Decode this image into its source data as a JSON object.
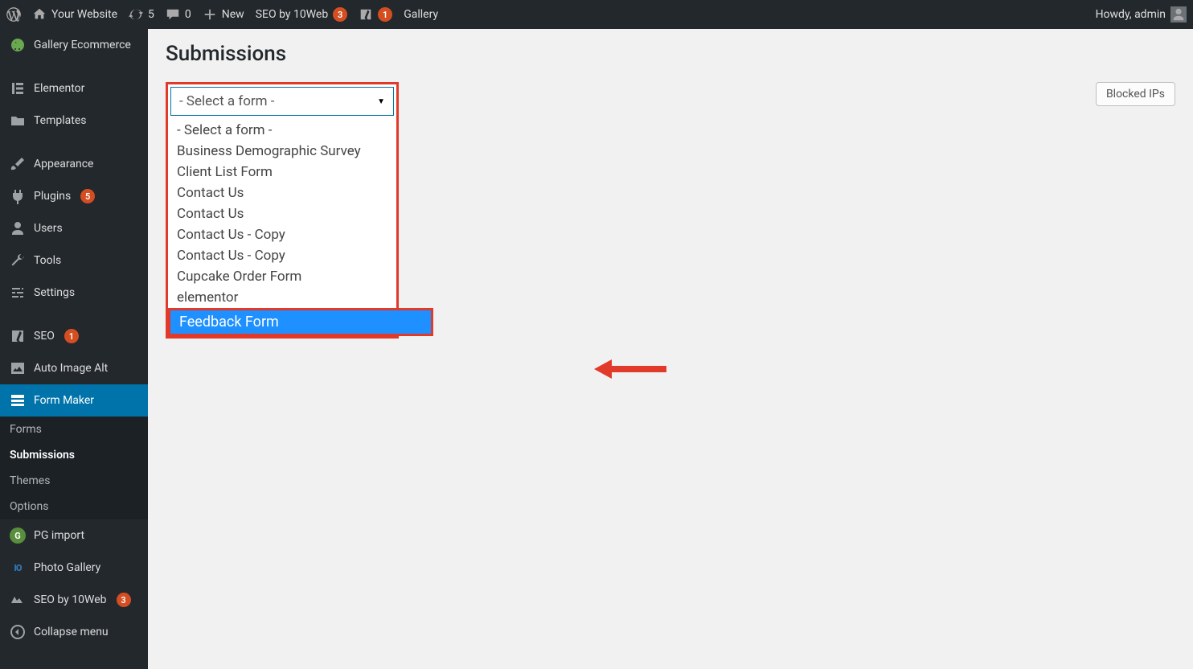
{
  "adminbar": {
    "site_name": "Your Website",
    "refresh_count": "5",
    "comment_count": "0",
    "new_label": "New",
    "seo_label": "SEO by 10Web",
    "seo_badge": "3",
    "yoast_badge": "1",
    "gallery_label": "Gallery",
    "greeting": "Howdy, admin"
  },
  "sidebar": {
    "gallery_ecommerce": "Gallery Ecommerce",
    "elementor": "Elementor",
    "templates": "Templates",
    "appearance": "Appearance",
    "plugins": "Plugins",
    "plugins_badge": "5",
    "users": "Users",
    "tools": "Tools",
    "settings": "Settings",
    "seo": "SEO",
    "seo_badge": "1",
    "auto_image_alt": "Auto Image Alt",
    "form_maker": "Form Maker",
    "sub": {
      "forms": "Forms",
      "submissions": "Submissions",
      "themes": "Themes",
      "options": "Options"
    },
    "pg_import": "PG import",
    "photo_gallery": "Photo Gallery",
    "seo_10web": "SEO by 10Web",
    "seo_10web_badge": "3",
    "collapse": "Collapse menu"
  },
  "main": {
    "heading": "Submissions",
    "blocked_ips_btn": "Blocked IPs",
    "select": {
      "placeholder": "- Select a form -",
      "options": [
        "- Select a form -",
        "Business Demographic Survey",
        "Client List Form",
        "Contact Us",
        "Contact Us",
        "Contact Us - Copy",
        "Contact Us - Copy",
        "Cupcake Order Form",
        "elementor"
      ],
      "highlighted": "Feedback Form"
    }
  }
}
